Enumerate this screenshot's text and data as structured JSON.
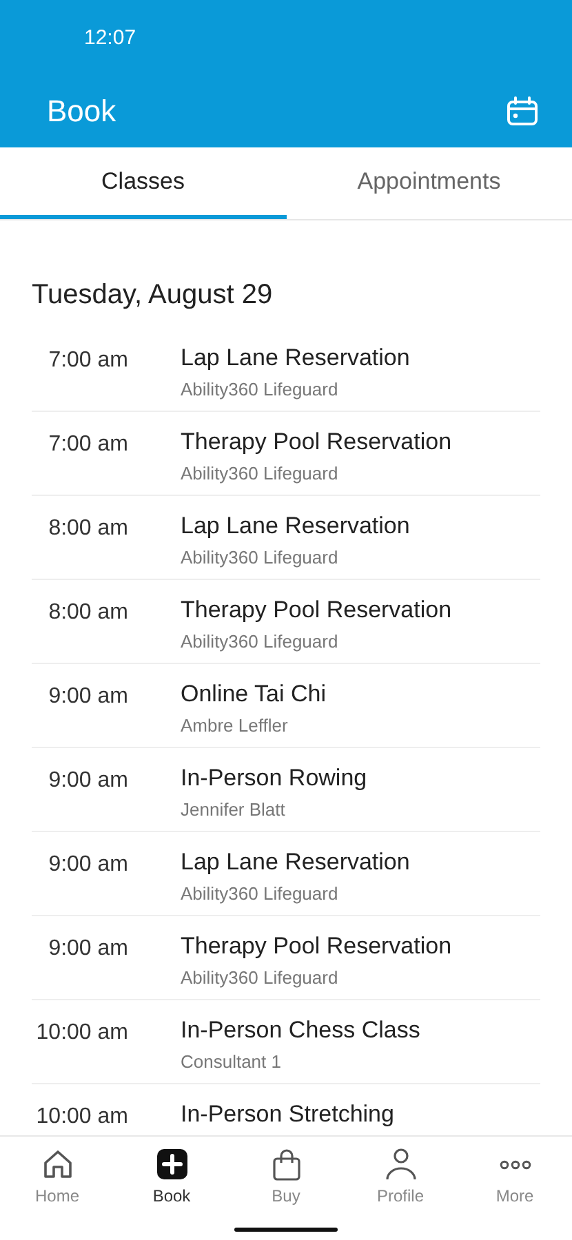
{
  "status_bar": {
    "time": "12:07"
  },
  "app_bar": {
    "title": "Book"
  },
  "tabs": [
    {
      "label": "Classes",
      "selected": true
    },
    {
      "label": "Appointments",
      "selected": false
    }
  ],
  "date_heading": "Tuesday, August 29",
  "classes": [
    {
      "time": "7:00 am",
      "name": "Lap Lane Reservation",
      "staff": "Ability360 Lifeguard"
    },
    {
      "time": "7:00 am",
      "name": "Therapy Pool Reservation",
      "staff": "Ability360 Lifeguard"
    },
    {
      "time": "8:00 am",
      "name": "Lap Lane Reservation",
      "staff": "Ability360 Lifeguard"
    },
    {
      "time": "8:00 am",
      "name": "Therapy Pool Reservation",
      "staff": "Ability360 Lifeguard"
    },
    {
      "time": "9:00 am",
      "name": "Online Tai Chi",
      "staff": "Ambre Leffler"
    },
    {
      "time": "9:00 am",
      "name": "In-Person Rowing",
      "staff": "Jennifer Blatt"
    },
    {
      "time": "9:00 am",
      "name": "Lap Lane Reservation",
      "staff": "Ability360 Lifeguard"
    },
    {
      "time": "9:00 am",
      "name": "Therapy Pool Reservation",
      "staff": "Ability360 Lifeguard"
    },
    {
      "time": "10:00 am",
      "name": "In-Person Chess Class",
      "staff": "Consultant 1"
    },
    {
      "time": "10:00 am",
      "name": "In-Person Stretching"
    }
  ],
  "bottom_nav": [
    {
      "kind": "home",
      "label": "Home",
      "selected": false
    },
    {
      "kind": "book",
      "label": "Book",
      "selected": true
    },
    {
      "kind": "buy",
      "label": "Buy",
      "selected": false
    },
    {
      "kind": "profile",
      "label": "Profile",
      "selected": false
    },
    {
      "kind": "more",
      "label": "More",
      "selected": false
    }
  ]
}
